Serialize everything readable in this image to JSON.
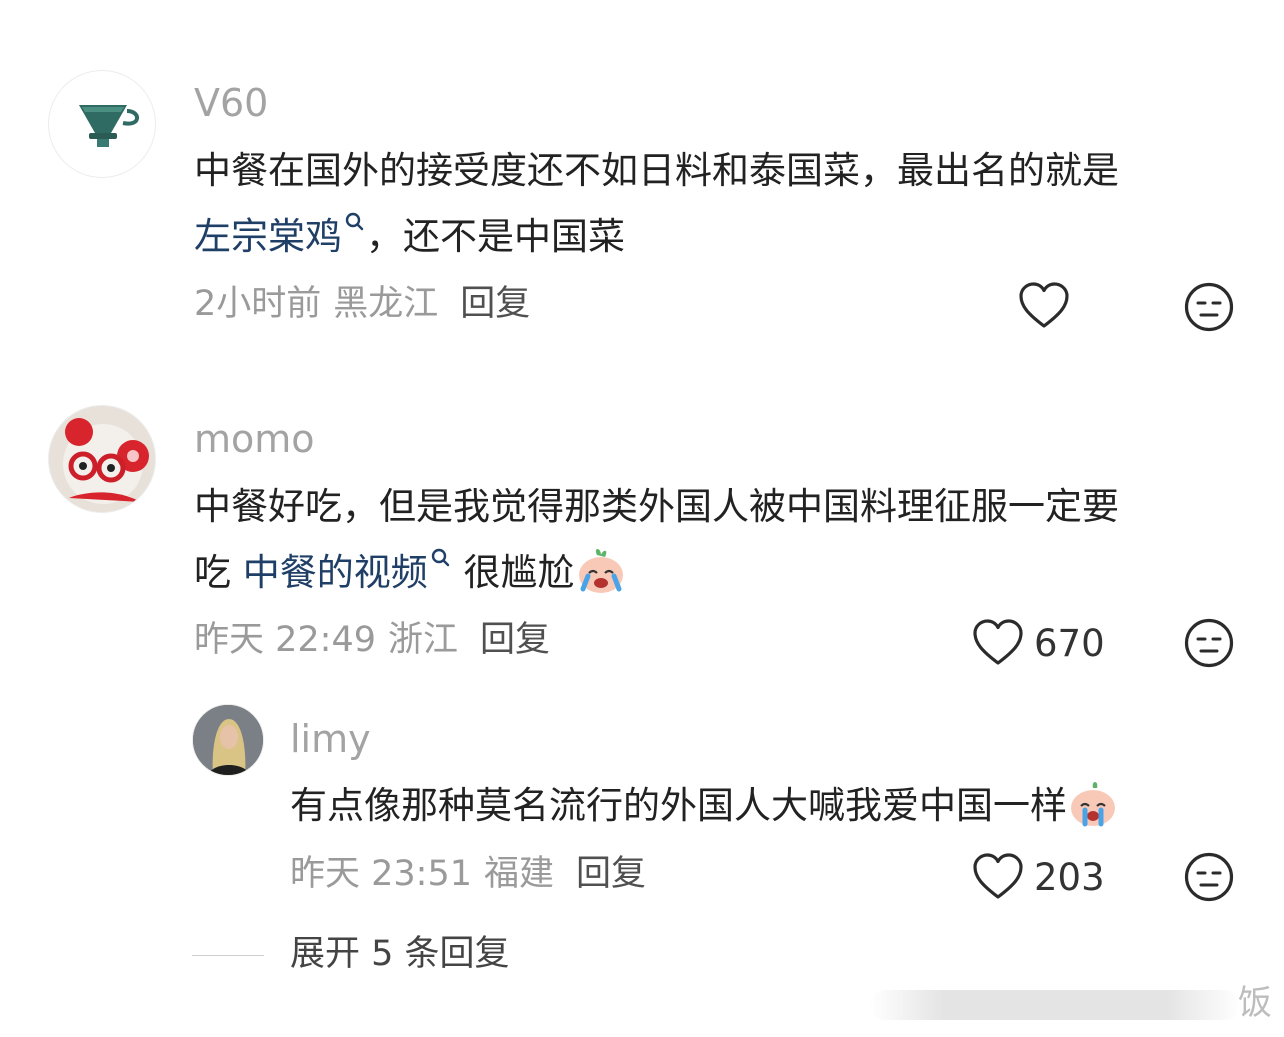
{
  "comments": [
    {
      "avatar": "pour-over-dripper",
      "username": "V60",
      "line1": "中餐在国外的接受度还不如日料和泰国菜，最出名的就是",
      "line2_link": "左宗棠鸡",
      "line2_rest": "，还不是中国菜",
      "time": "2小时前",
      "location": "黑龙江",
      "reply": "回复",
      "likes": ""
    },
    {
      "avatar": "hello-kitty-headband",
      "username": "momo",
      "line1": "中餐好吃，但是我觉得那类外国人被中国料理征服一定要",
      "line2_pre": "吃 ",
      "line2_link": "中餐的视频",
      "line2_rest": " 很尴尬",
      "emoji": "crying-peach-emoji",
      "time": "昨天 22:49",
      "location": "浙江",
      "reply": "回复",
      "likes": "670"
    },
    {
      "avatar": "blonde-person",
      "username": "limy",
      "line1": "有点像那种莫名流行的外国人大喊我爱中国一样",
      "emoji": "crying-peach-emoji",
      "time": "昨天 23:51",
      "location": "福建",
      "reply": "回复",
      "likes": "203"
    }
  ],
  "expand": "展开 5 条回复",
  "watermark": "饭",
  "colors": {
    "link": "#1f3f67",
    "meta": "#9a9a9a",
    "username": "#a3a3a3"
  }
}
